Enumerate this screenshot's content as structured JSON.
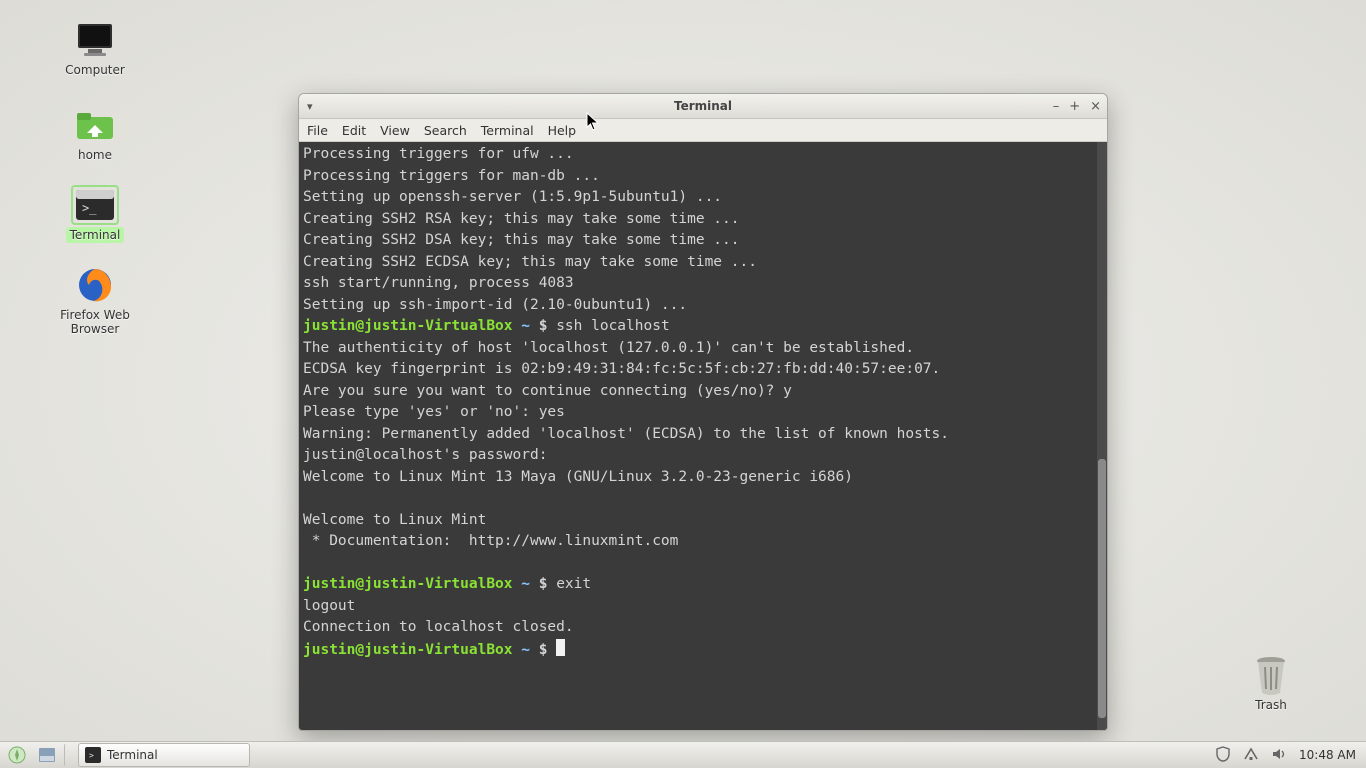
{
  "desktop_icons": {
    "computer": "Computer",
    "home": "home",
    "terminal": "Terminal",
    "firefox": "Firefox Web Browser",
    "trash": "Trash"
  },
  "window": {
    "title": "Terminal",
    "menu_indicator": "▾",
    "minimize": "–",
    "maximize": "+",
    "close": "×"
  },
  "menubar": [
    "File",
    "Edit",
    "View",
    "Search",
    "Terminal",
    "Help"
  ],
  "prompt": {
    "userhost": "justin@justin-VirtualBox",
    "path": "~",
    "sigil": "$"
  },
  "terminal_lines": {
    "l0": "Processing triggers for ufw ...",
    "l1": "Processing triggers for man-db ...",
    "l2": "Setting up openssh-server (1:5.9p1-5ubuntu1) ...",
    "l3": "Creating SSH2 RSA key; this may take some time ...",
    "l4": "Creating SSH2 DSA key; this may take some time ...",
    "l5": "Creating SSH2 ECDSA key; this may take some time ...",
    "l6": "ssh start/running, process 4083",
    "l7": "Setting up ssh-import-id (2.10-0ubuntu1) ...",
    "cmd1": "ssh localhost",
    "l8": "The authenticity of host 'localhost (127.0.0.1)' can't be established.",
    "l9": "ECDSA key fingerprint is 02:b9:49:31:84:fc:5c:5f:cb:27:fb:dd:40:57:ee:07.",
    "l10": "Are you sure you want to continue connecting (yes/no)? y",
    "l11": "Please type 'yes' or 'no': yes",
    "l12": "Warning: Permanently added 'localhost' (ECDSA) to the list of known hosts.",
    "l13": "justin@localhost's password:",
    "l14": "Welcome to Linux Mint 13 Maya (GNU/Linux 3.2.0-23-generic i686)",
    "blank": " ",
    "l15": "Welcome to Linux Mint",
    "l16": " * Documentation:  http://www.linuxmint.com",
    "cmd2": "exit",
    "l17": "logout",
    "l18": "Connection to localhost closed."
  },
  "taskbar": {
    "task_label": "Terminal",
    "clock": "10:48 AM"
  }
}
